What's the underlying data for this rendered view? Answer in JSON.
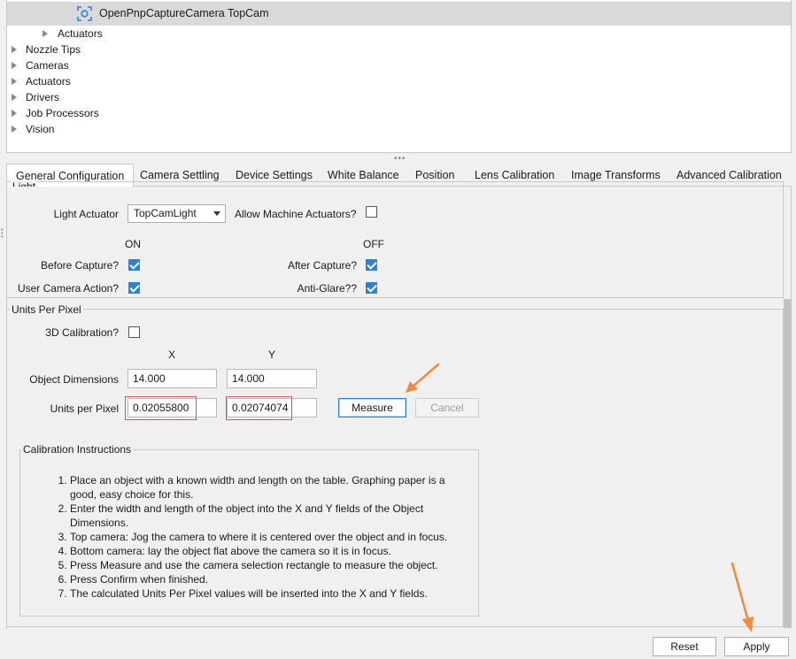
{
  "tree": {
    "selected_camera": "OpenPnpCaptureCamera TopCam",
    "sub_item": "Actuators",
    "items": [
      "Nozzle Tips",
      "Cameras",
      "Actuators",
      "Drivers",
      "Job Processors",
      "Vision"
    ]
  },
  "tabs": [
    "General Configuration",
    "Camera Settling",
    "Device Settings",
    "White Balance",
    "Position",
    "Lens Calibration",
    "Image Transforms",
    "Advanced Calibration"
  ],
  "light": {
    "title": "Light",
    "actuator_label": "Light Actuator",
    "actuator_value": "TopCamLight",
    "allow_machine_label": "Allow Machine Actuators?",
    "on_header": "ON",
    "off_header": "OFF",
    "before_capture_label": "Before Capture?",
    "after_capture_label": "After Capture?",
    "user_camera_label": "User Camera Action?",
    "anti_glare_label": "Anti-Glare??"
  },
  "units": {
    "title": "Units Per Pixel",
    "calib_3d_label": "3D Calibration?",
    "x_header": "X",
    "y_header": "Y",
    "object_dim_label": "Object Dimensions",
    "object_x": "14.000",
    "object_y": "14.000",
    "upp_label": "Units per Pixel",
    "upp_x": "0.02055800",
    "upp_y": "0.02074074",
    "measure_label": "Measure",
    "cancel_label": "Cancel"
  },
  "instructions": {
    "title": "Calibration Instructions",
    "steps": [
      "Place an object with a known width and length on the table. Graphing paper is a good, easy choice for this.",
      "Enter the width and length of the object into the X and Y fields of the Object Dimensions.",
      "Top camera: Jog the camera to where it is centered over the object and in focus.",
      "Bottom camera: lay the object flat above the camera so it is in focus.",
      "Press Measure and use the camera selection rectangle to measure the object.",
      "Press Confirm when finished.",
      "The calculated Units Per Pixel values will be inserted into the X and Y fields."
    ]
  },
  "footer": {
    "reset_label": "Reset",
    "apply_label": "Apply"
  },
  "colors": {
    "accent": "#2c82d8",
    "annotation_arrow": "#f58a3c",
    "highlight_box": "#e05050"
  }
}
